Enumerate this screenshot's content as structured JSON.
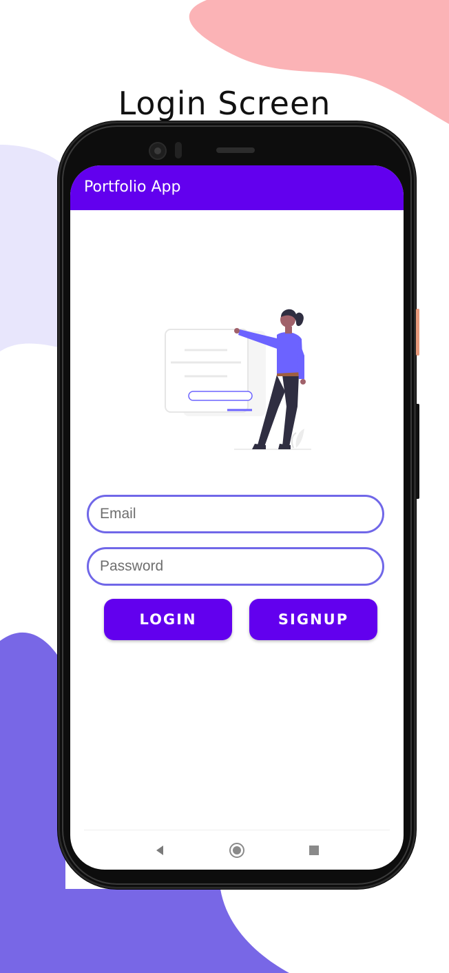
{
  "page": {
    "title": "Login Screen"
  },
  "colors": {
    "accent": "#6200ee",
    "field_border": "#7067e8",
    "blob_pink": "#fbb3b6",
    "blob_lavender": "#e8e6fc",
    "blob_purple": "#7867e6"
  },
  "app": {
    "title": "Portfolio App",
    "email_field": {
      "placeholder": "Email",
      "value": ""
    },
    "password_field": {
      "placeholder": "Password",
      "value": ""
    },
    "login_button": "LOGIN",
    "signup_button": "SIGNUP"
  },
  "nav": {
    "icons": [
      "back-icon",
      "home-icon",
      "recents-icon"
    ]
  }
}
